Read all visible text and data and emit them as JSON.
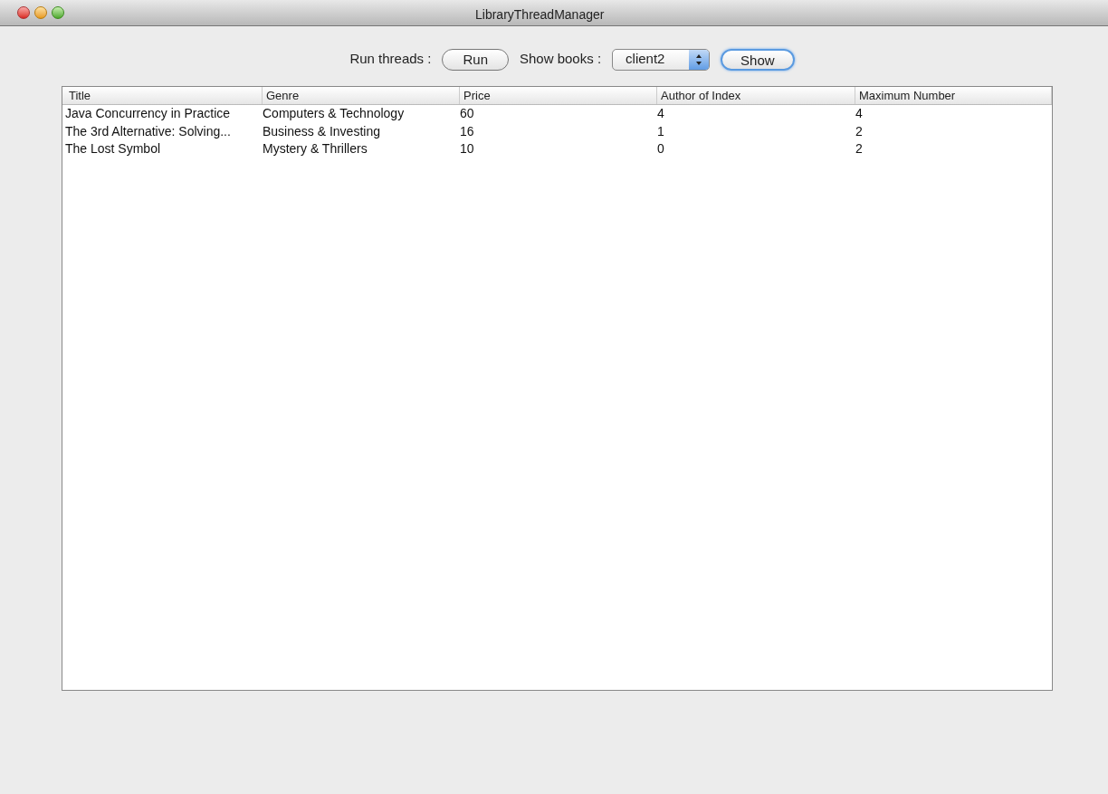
{
  "window": {
    "title": "LibraryThreadManager"
  },
  "toolbar": {
    "run_label": "Run threads :",
    "run_button": {
      "label": "Run",
      "focused": false
    },
    "show_label": "Show books :",
    "client_select": {
      "value": "client2"
    },
    "show_button": {
      "label": "Show",
      "focused": true
    }
  },
  "table": {
    "columns": [
      "Title",
      "Genre",
      "Price",
      "Author of Index",
      "Maximum Number"
    ],
    "rows": [
      [
        "Java Concurrency in Practice",
        "Computers & Technology",
        "60",
        "4",
        "4"
      ],
      [
        "The 3rd Alternative: Solving...",
        "Business & Investing",
        "16",
        "1",
        "2"
      ],
      [
        "The Lost Symbol",
        "Mystery & Thrillers",
        "10",
        "0",
        "2"
      ]
    ]
  }
}
